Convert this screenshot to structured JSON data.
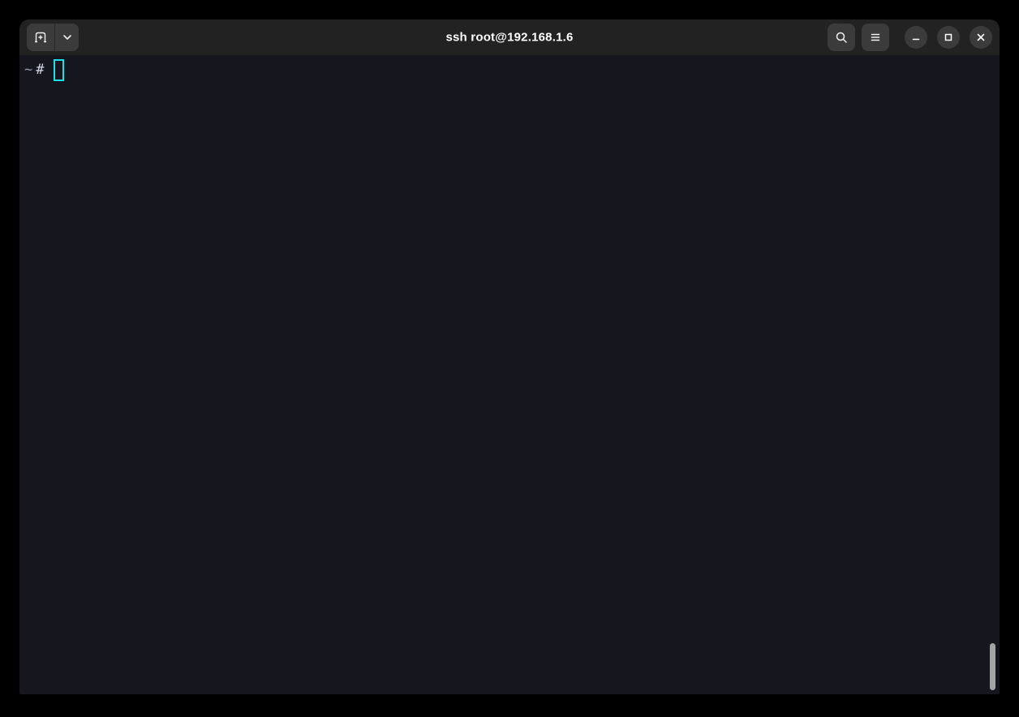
{
  "window": {
    "title": "ssh root@192.168.1.6"
  },
  "header": {
    "buttons": {
      "new_tab": "new-tab",
      "tabs_dropdown": "tabs-dropdown",
      "search": "search",
      "menu": "main-menu",
      "minimize": "minimize",
      "maximize": "maximize",
      "close": "close"
    }
  },
  "terminal": {
    "prompt_path": "~",
    "prompt_symbol": "#",
    "cursor_style": "hollow-block"
  },
  "colors": {
    "desktop_background": "#000000",
    "headerbar_background": "#222222",
    "button_background": "#3b3b3b",
    "terminal_background": "#16161f",
    "prompt_path_color": "#9298ac",
    "prompt_symbol_color": "#d7dbe8",
    "cursor_color": "#1fe0e6",
    "title_color": "#ffffff",
    "scrollbar_thumb": "#a3a3a6"
  }
}
